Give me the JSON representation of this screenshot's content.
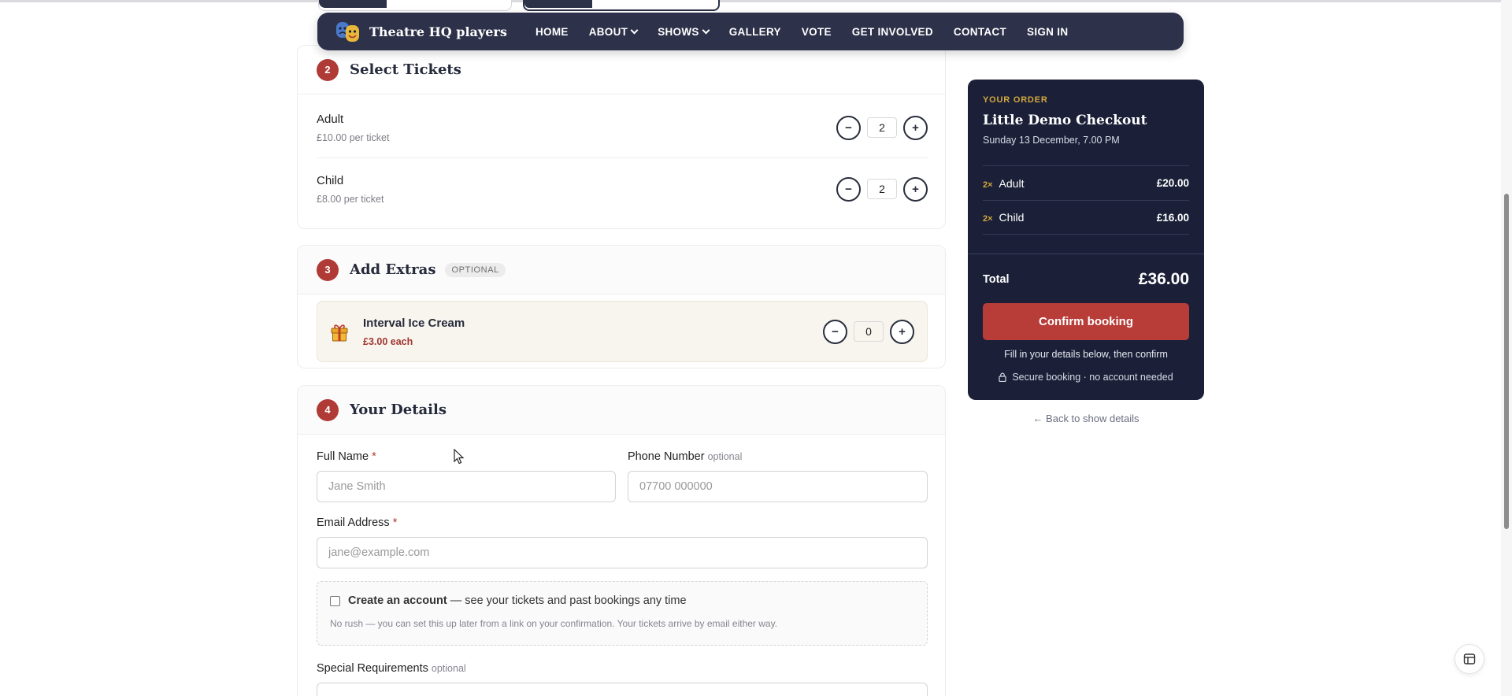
{
  "nav": {
    "brand": "Theatre HQ players",
    "links": [
      "HOME",
      "ABOUT",
      "SHOWS",
      "GALLERY",
      "VOTE",
      "GET INVOLVED",
      "CONTACT",
      "SIGN IN"
    ]
  },
  "tickets": {
    "step": "2",
    "title": "Select Tickets",
    "items": [
      {
        "name": "Adult",
        "price": "£10.00 per ticket",
        "qty": "2"
      },
      {
        "name": "Child",
        "price": "£8.00 per ticket",
        "qty": "2"
      }
    ]
  },
  "extras": {
    "step": "3",
    "title": "Add Extras",
    "badge": "OPTIONAL",
    "item": {
      "name": "Interval Ice Cream",
      "price": "£3.00 each",
      "qty": "0"
    }
  },
  "details": {
    "step": "4",
    "title": "Your Details",
    "full_name_label": "Full Name",
    "full_name_placeholder": "Jane Smith",
    "phone_label": "Phone Number",
    "phone_optional": "optional",
    "phone_placeholder": "07700 000000",
    "email_label": "Email Address",
    "email_placeholder": "jane@example.com",
    "required_mark": "*",
    "account_title": "Create an account",
    "account_desc": "— see your tickets and past bookings any time",
    "account_note": "No rush — you can set this up later from a link on your confirmation. Your tickets arrive by email either way.",
    "special_label": "Special Requirements",
    "special_optional": "optional"
  },
  "order": {
    "kicker": "YOUR ORDER",
    "show": "Little Demo Checkout",
    "date": "Sunday 13 December, 7.00 PM",
    "lines": [
      {
        "mult": "2×",
        "name": "Adult",
        "amount": "£20.00"
      },
      {
        "mult": "2×",
        "name": "Child",
        "amount": "£16.00"
      }
    ],
    "total_label": "Total",
    "total": "£36.00",
    "confirm": "Confirm booking",
    "fill_note": "Fill in your details below, then confirm",
    "secure_note": "Secure booking · no account needed",
    "back": "← Back to show details"
  },
  "colors": {
    "nav_bg": "#2d3149",
    "accent_red": "#b03a35",
    "panel_bg": "#1b2038",
    "gold": "#d4a83e"
  }
}
